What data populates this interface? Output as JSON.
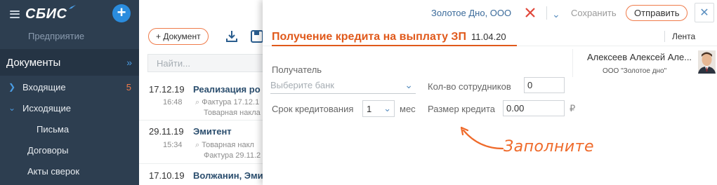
{
  "sidebar": {
    "logo": "СБИС",
    "company": "Предприятие",
    "section": "Документы",
    "items": [
      {
        "label": "Входящие",
        "count": "5"
      },
      {
        "label": "Исходящие"
      },
      {
        "label": "Письма"
      },
      {
        "label": "Договоры"
      },
      {
        "label": "Акты сверок"
      }
    ]
  },
  "list": {
    "add_button": "+ Документ",
    "search_placeholder": "Найти...",
    "rows": [
      {
        "date": "17.12.19",
        "time": "16:48",
        "title": "Реализация ро",
        "sub1": "Фактура 17.12.1",
        "sub2": "Товарная накла"
      },
      {
        "date": "29.11.19",
        "time": "15:34",
        "title": "Эмитент",
        "sub1": "Товарная накл",
        "sub2": "Фактура 29.11.2"
      },
      {
        "date": "17.10.19",
        "time": "",
        "title": "Волжанин, Эми",
        "sub1": "",
        "sub2": ""
      }
    ]
  },
  "panel": {
    "company": "Золотое Дно, ООО",
    "save_label": "Сохранить",
    "send_label": "Отправить",
    "title": "Получение кредита на выплату ЗП",
    "date": "11.04.20",
    "tape_label": "Лента",
    "user": {
      "name": "Алексеев Алексей Але...",
      "org": "ООО \"Золотое дно\""
    },
    "form": {
      "recipient_label": "Получатель",
      "bank_placeholder": "Выберите банк",
      "employees_label": "Кол-во сотрудников",
      "employees_value": "0",
      "term_label": "Срок кредитования",
      "term_value": "1",
      "term_unit": "мес",
      "amount_label": "Размер кредита",
      "amount_value": "0.00",
      "currency": "₽"
    },
    "hint": "Заполните"
  },
  "colors": {
    "sidebar_bg": "#2d3e50",
    "accent_orange": "#e0591b",
    "accent_blue": "#2a8cde"
  }
}
